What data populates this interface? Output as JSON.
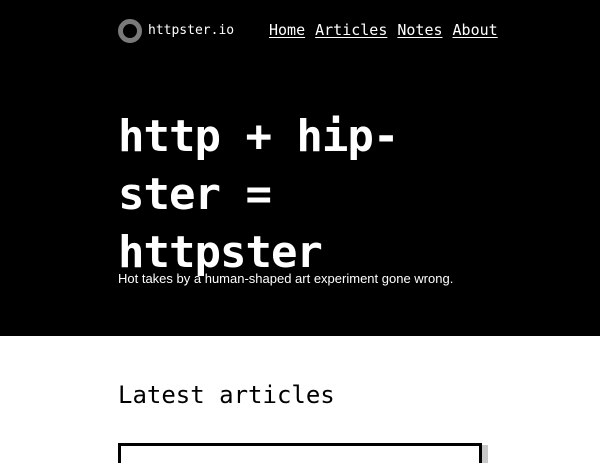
{
  "header": {
    "site_name": "httpster.io",
    "logo_icon": "ring-logo-icon",
    "nav": [
      {
        "label": "Home"
      },
      {
        "label": "Articles"
      },
      {
        "label": "Notes"
      },
      {
        "label": "About"
      }
    ]
  },
  "hero": {
    "headline_lines": [
      "http + hip-",
      "ster =",
      "httpster"
    ],
    "tagline": "Hot takes by a human-shaped art experiment gone wrong."
  },
  "latest": {
    "title": "Latest articles"
  },
  "colors": {
    "hero_background": "#000000",
    "page_background": "#ffffff",
    "logo_ring": "#7a7a7a"
  }
}
